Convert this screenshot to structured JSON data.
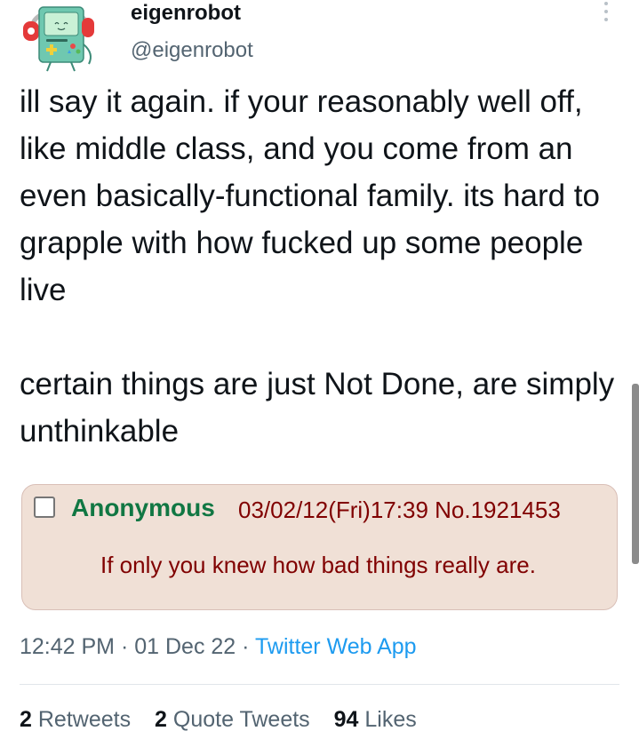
{
  "tweet": {
    "author": {
      "display_name": "eigenrobot",
      "handle": "@eigenrobot",
      "avatar_icon": "bmo-robot-with-headphones-icon"
    },
    "more_icon": "more-vertical-icon",
    "body": {
      "paragraph_1": "ill say it again. if your reasonably well off, like middle class, and you come from an even basically-functional family. its hard to grapple with how fucked up some people live",
      "paragraph_2": "certain things are just Not Done, are simply unthinkable"
    },
    "embedded_image": {
      "name": "Anonymous",
      "meta": "03/02/12(Fri)17:39 No.1921453",
      "text": "If only you knew how bad things really are.",
      "colors": {
        "background": "#f0e0d6",
        "name": "#117743",
        "text": "#800000"
      }
    },
    "timestamp": {
      "time": "12:42 PM",
      "separator": "·",
      "date": "01 Dec 22",
      "separator_2": "·",
      "source": "Twitter Web App"
    },
    "stats": {
      "retweets_count": "2",
      "retweets_label": "Retweets",
      "quotes_count": "2",
      "quotes_label": "Quote Tweets",
      "likes_count": "94",
      "likes_label": "Likes"
    }
  },
  "colors": {
    "text_primary": "#0f1419",
    "text_secondary": "#536471",
    "link": "#1d9bf0"
  }
}
